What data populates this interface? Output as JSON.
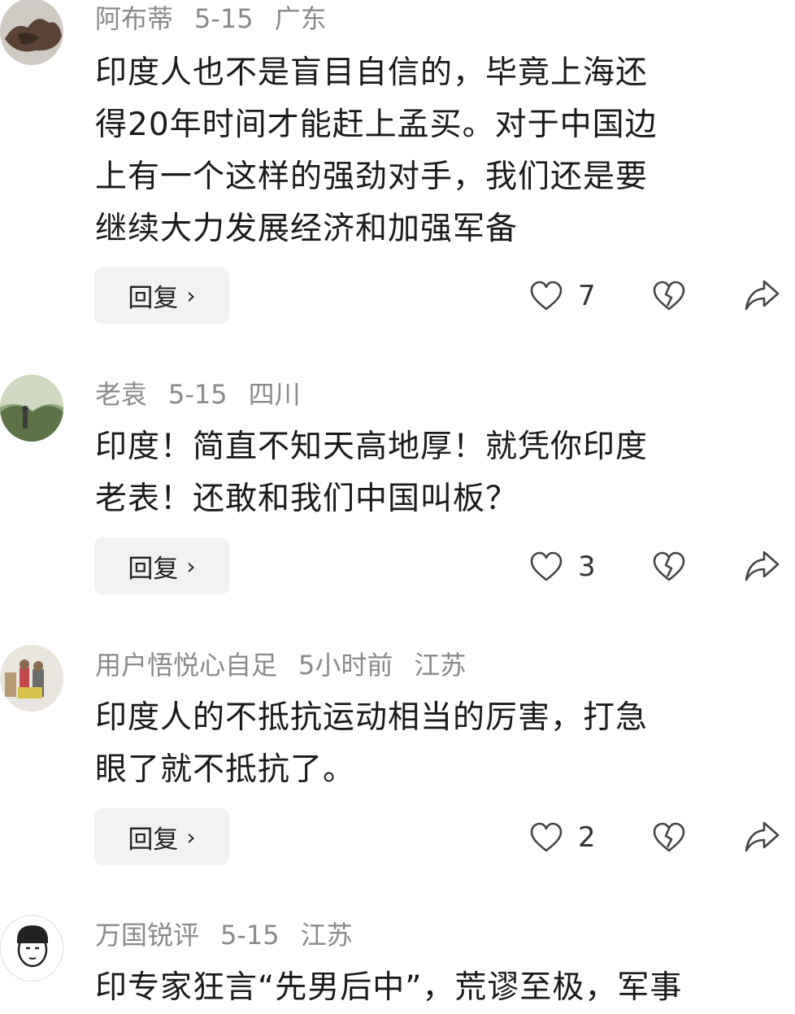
{
  "comments": [
    {
      "user": "阿布蒂",
      "date": "5-15",
      "location": "广东",
      "text": "印度人也不是盲目自信的，毕竟上海还\n得20年时间才能赶上孟买。对于中国边\n上有一个这样的强劲对手，我们还是要\n继续大力发展经济和加强军备",
      "reply_label": "回复",
      "chevron": "›",
      "likes": "7",
      "avatar_icon": "avatar-photo"
    },
    {
      "user": "老袁",
      "date": "5-15",
      "location": "四川",
      "text": "印度！简直不知天高地厚！就凭你印度\n老表！还敢和我们中国叫板？",
      "reply_label": "回复",
      "chevron": "›",
      "likes": "3",
      "avatar_icon": "avatar-photo"
    },
    {
      "user": "用户悟悦心自足",
      "date": "5小时前",
      "location": "江苏",
      "text": "印度人的不抵抗运动相当的厉害，打急\n眼了就不抵抗了。",
      "reply_label": "回复",
      "chevron": "›",
      "likes": "2",
      "avatar_icon": "avatar-photo"
    },
    {
      "user": "万国锐评",
      "date": "5-15",
      "location": "江苏",
      "text": "印专家狂言“先男后中”，荒谬至极，军事",
      "avatar_icon": "avatar-cartoon"
    }
  ],
  "icons": {
    "like": "heart-icon",
    "dislike": "broken-heart-icon",
    "share": "share-arrow-icon"
  },
  "colors": {
    "meta_text": "#8a8a8a",
    "body_text": "#1a1a1a",
    "button_bg": "#f2f2f2"
  }
}
